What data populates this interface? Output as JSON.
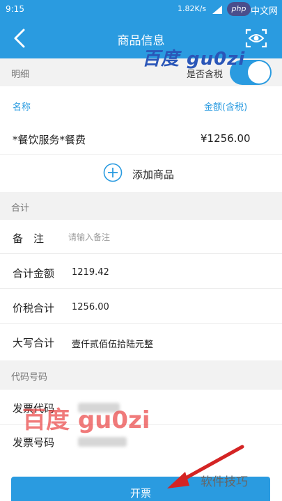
{
  "status_bar": {
    "time": "9:15",
    "network_speed": "1.82K/s",
    "php_badge": "php",
    "php_suffix": "中文网"
  },
  "nav": {
    "title": "商品信息",
    "back_icon": "chevron-left-icon",
    "scan_icon": "eye-scan-icon"
  },
  "details": {
    "section_label": "明细",
    "tax_toggle_label": "是否含税",
    "tax_toggle_on": true,
    "col_name": "名称",
    "col_amount": "金额(含税)",
    "items": [
      {
        "name": "*餐饮服务*餐费",
        "amount": "¥1256.00"
      }
    ],
    "add_label": "添加商品"
  },
  "totals": {
    "section_label": "合计",
    "remark_label": "备　注",
    "remark_placeholder": "请输入备注",
    "amount_label": "合计金额",
    "amount_value": "1219.42",
    "tax_total_label": "价税合计",
    "tax_total_value": "1256.00",
    "uppercase_label": "大写合计",
    "uppercase_value": "壹仟贰佰伍拾陆元整"
  },
  "code": {
    "section_label": "代码号码",
    "invoice_code_label": "发票代码",
    "invoice_number_label": "发票号码"
  },
  "watermarks": {
    "top": "百度 gu0zi",
    "red": "百度 gu0zi",
    "tip": "软件技巧"
  },
  "actions": {
    "issue_label": "开票"
  },
  "colors": {
    "primary": "#2a9be0",
    "section_bg": "#f2f2f2",
    "watermark_red": "#e62828"
  }
}
